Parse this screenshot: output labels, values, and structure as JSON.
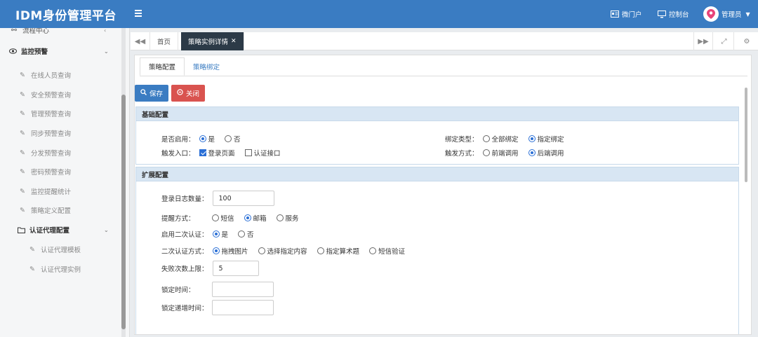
{
  "header": {
    "brand": "IDM身份管理平台",
    "portal_label": "微门户",
    "console_label": "控制台",
    "user_label": "管理员"
  },
  "sidebar": {
    "top_cut_item": "流程中心",
    "group_monitor": "监控预警",
    "monitor_items": [
      {
        "label": "在线人员查询"
      },
      {
        "label": "安全预警查询"
      },
      {
        "label": "管理预警查询"
      },
      {
        "label": "同步预警查询"
      },
      {
        "label": "分发预警查询"
      },
      {
        "label": "密码预警查询"
      },
      {
        "label": "监控提醒统计"
      },
      {
        "label": "策略定义配置"
      }
    ],
    "group_auth_proxy": "认证代理配置",
    "auth_proxy_items": [
      {
        "label": "认证代理模板"
      },
      {
        "label": "认证代理实例"
      }
    ]
  },
  "tabs": {
    "home": "首页",
    "active": "策略实例详情"
  },
  "subtabs": {
    "config": "策略配置",
    "binding": "策略绑定"
  },
  "toolbar": {
    "save": "保存",
    "close": "关闭"
  },
  "basic": {
    "title": "基础配置",
    "enabled_label": "是否启用：",
    "enabled_yes": "是",
    "enabled_no": "否",
    "entry_label": "触发入口：",
    "entry_login": "登录页面",
    "entry_auth_api": "认证接口",
    "bind_type_label": "绑定类型：",
    "bind_all": "全部绑定",
    "bind_specified": "指定绑定",
    "trigger_label": "触发方式：",
    "trigger_pre": "前端调用",
    "trigger_post": "后端调用"
  },
  "extended": {
    "title": "扩展配置",
    "log_count_label": "登录日志数量：",
    "log_count_value": "100",
    "remind_label": "提醒方式：",
    "remind_sms": "短信",
    "remind_email": "邮箱",
    "remind_service": "服务",
    "second_auth_label": "启用二次认证：",
    "second_auth_yes": "是",
    "second_auth_no": "否",
    "second_method_label": "二次认证方式：",
    "method_drag": "拖拽图片",
    "method_select": "选择指定内容",
    "method_math": "指定算术题",
    "method_sms": "短信验证",
    "fail_limit_label": "失败次数上限：",
    "fail_limit_value": "5",
    "lock_time_label": "锁定时间：",
    "lock_time_value": "",
    "lock_incr_label": "锁定递增时间：",
    "lock_incr_value": ""
  },
  "colors": {
    "topbar": "#3a7cc2",
    "save_button": "#3a7cc2",
    "close_button": "#d9534f",
    "active_tab": "#2c3a47",
    "section_header": "#d8e6f3"
  }
}
